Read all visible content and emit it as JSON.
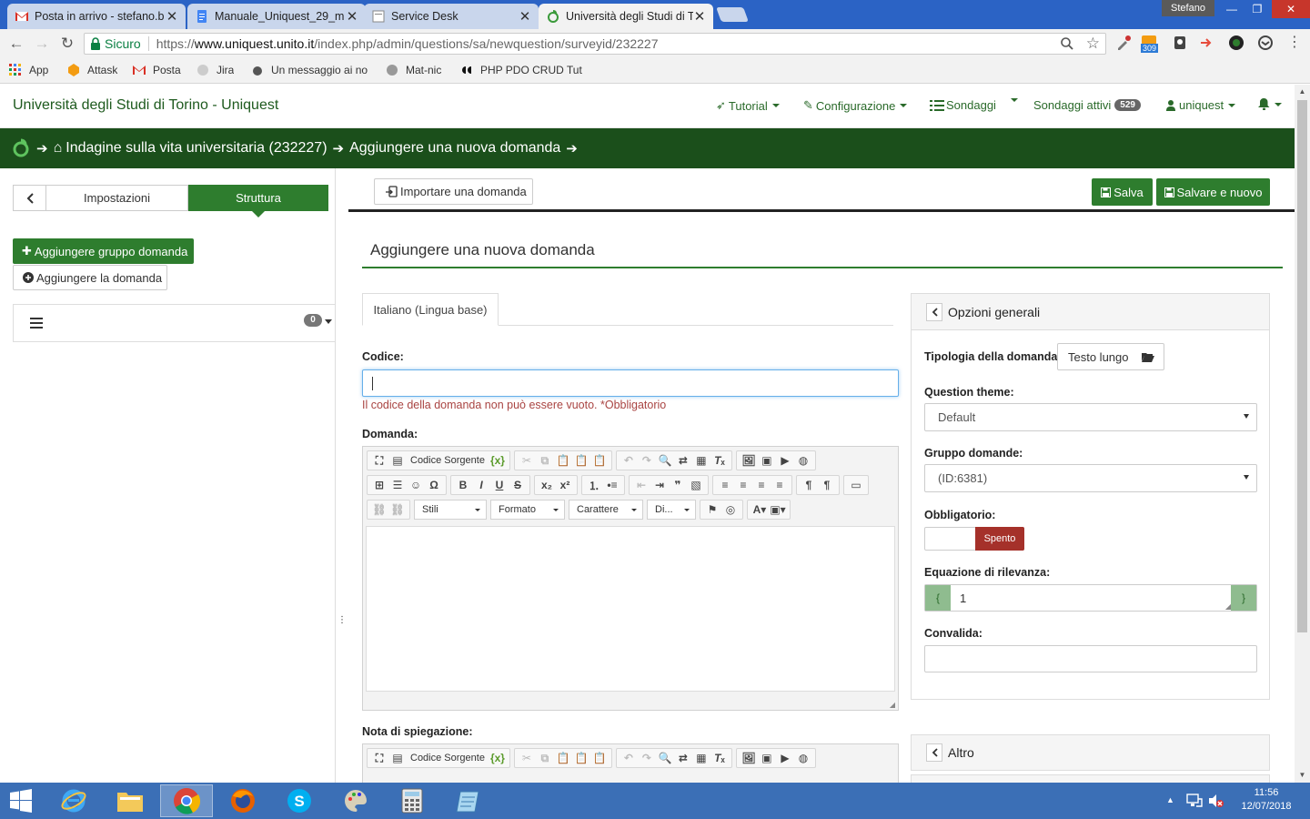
{
  "browser": {
    "tabs": [
      {
        "title": "Posta in arrivo - stefano.b",
        "icon": "gmail-icon"
      },
      {
        "title": "Manuale_Uniquest_29_m",
        "icon": "docs-icon"
      },
      {
        "title": "Service Desk",
        "icon": "page-icon"
      },
      {
        "title": "Università degli Studi di T",
        "icon": "uniquest-icon"
      }
    ],
    "user": "Stefano",
    "secure_label": "Sicuro",
    "url_scheme": "https://",
    "url_host": "www.uniquest.unito.it",
    "url_path": "/index.php/admin/questions/sa/newquestion/surveyid/232227",
    "ext_badge": "309",
    "bookmarks": [
      "App",
      "Attask",
      "Posta",
      "Jira",
      "Un messaggio ai no",
      "Mat-nic",
      "PHP PDO CRUD Tut"
    ]
  },
  "app": {
    "brand": "Università degli Studi di Torino - Uniquest",
    "nav": {
      "tutorial": "Tutorial",
      "config": "Configurazione",
      "surveys": "Sondaggi",
      "active_surveys": "Sondaggi attivi",
      "active_count": "529",
      "user": "uniquest"
    },
    "breadcrumb": {
      "survey": "Indagine sulla vita universitaria (232227)",
      "page": "Aggiungere una nuova domanda"
    }
  },
  "sidebar": {
    "tab_settings": "Impostazioni",
    "tab_structure": "Struttura",
    "add_group": "Aggiungere gruppo domanda",
    "add_question": "Aggiungere la domanda",
    "tree_count": "0"
  },
  "main": {
    "import_label": "Importare una domanda",
    "save_label": "Salva",
    "save_new_label": "Salvare e nuovo",
    "title": "Aggiungere una nuova domanda",
    "lang_tab": "Italiano (Lingua base)",
    "code_label": "Codice:",
    "code_value": "",
    "code_error": "Il codice della domanda non può essere vuoto. *Obbligatorio",
    "question_label": "Domanda:",
    "help_label": "Nota di spiegazione:",
    "editor": {
      "source": "Codice Sorgente",
      "styles": "Stili",
      "format": "Formato",
      "font": "Carattere",
      "size": "Di..."
    }
  },
  "options": {
    "general_title": "Opzioni generali",
    "qtype_label": "Tipologia della domanda:",
    "qtype_value": "Testo lungo",
    "theme_label": "Question theme:",
    "theme_value": "Default",
    "group_label": "Gruppo domande:",
    "group_value": "(ID:6381)",
    "mandatory_label": "Obbligatorio:",
    "mandatory_value": "Spento",
    "relevance_label": "Equazione di rilevanza:",
    "relevance_value": "1",
    "validation_label": "Convalida:",
    "other_title": "Altro"
  },
  "taskbar": {
    "time": "11:56",
    "date": "12/07/2018"
  },
  "colors": {
    "brand_green": "#2e7d2e",
    "crumb_bg": "#1b4f1b",
    "danger": "#a5312a",
    "error_text": "#a94442"
  }
}
